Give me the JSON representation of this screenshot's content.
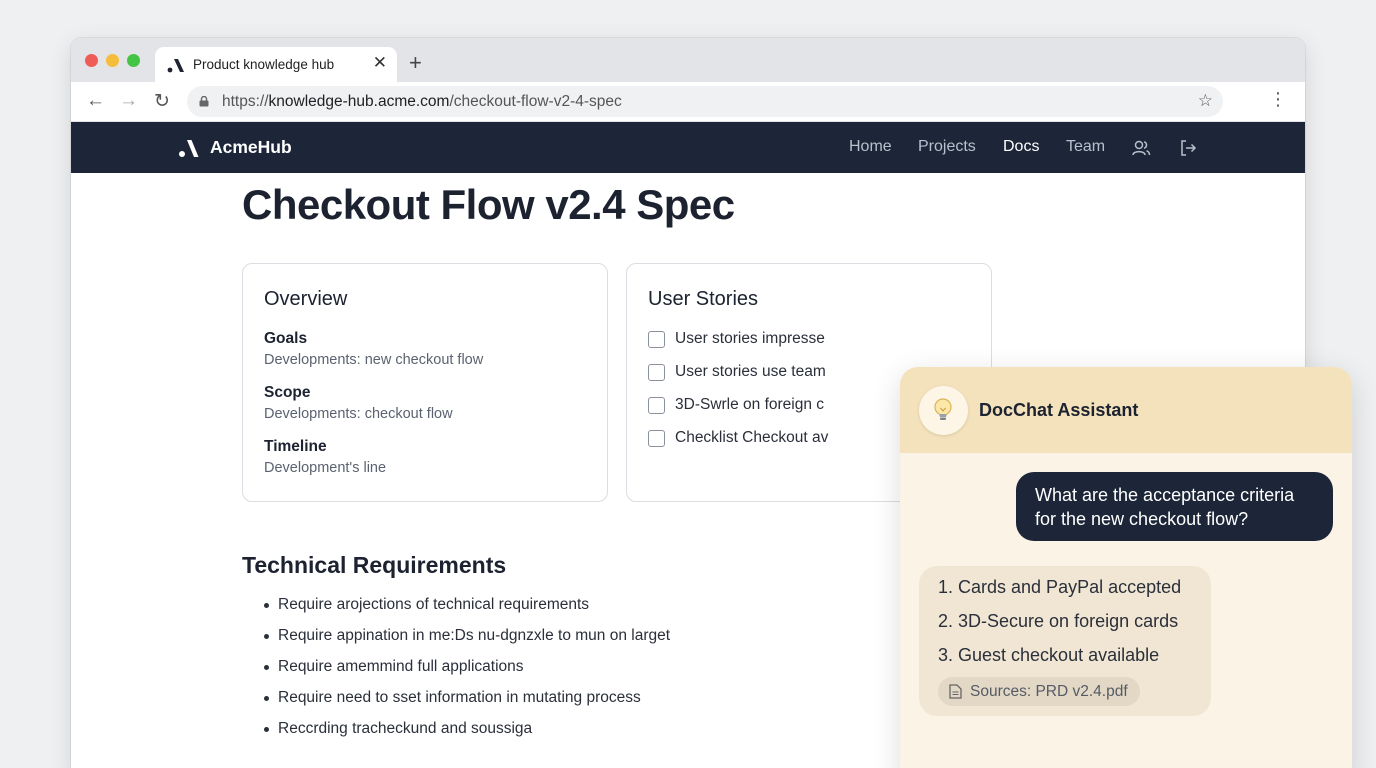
{
  "browser": {
    "tab_title": "Product knowledge hub",
    "url_prefix": "https://",
    "url_host": "knowledge-hub.acme.com",
    "url_path": "/checkout-flow-v2-4-spec"
  },
  "site": {
    "brand": "AcmeHub",
    "nav": [
      "Home",
      "Projects",
      "Docs",
      "Team"
    ],
    "active_nav": "Docs"
  },
  "page": {
    "title": "Checkout Flow v2.4 Spec",
    "overview": {
      "heading": "Overview",
      "items": [
        {
          "label": "Goals",
          "value": "Developments: new checkout flow"
        },
        {
          "label": "Scope",
          "value": "Developments: checkout flow"
        },
        {
          "label": "Timeline",
          "value": "Development's line"
        }
      ]
    },
    "user_stories": {
      "heading": "User Stories",
      "items": [
        "User stories impresse",
        "User stories use team",
        "3D-Swrle on foreign c",
        "Checklist Checkout av"
      ]
    },
    "technical": {
      "heading": "Technical Requirements",
      "items": [
        "Require arojections of technical requirements",
        "Require appination in me:Ds nu-dgnzxle to mun on larget",
        "Require amemmind full applications",
        "Require need to sset information in mutating process",
        "Reccrding tracheckund and soussiga"
      ]
    }
  },
  "chat": {
    "title": "DocChat Assistant",
    "user_message": "What are the acceptance criteria for the new checkout flow?",
    "bot_lines": [
      "1. Cards and PayPal accepted",
      "2. 3D-Secure on foreign cards",
      "3. Guest checkout available"
    ],
    "source": "Sources: PRD v2.4.pdf"
  },
  "icons": {
    "tab_logo": "acme-logo-icon",
    "lock": "lock-icon",
    "star": "bookmark-star-icon",
    "team": "users-icon",
    "logout": "logout-icon",
    "assistant": "lightbulb-icon",
    "file": "document-icon"
  },
  "colors": {
    "header_bg": "#1c2638",
    "chat_header": "#f4e2bc",
    "chat_bg": "#fbf4e6",
    "user_bubble": "#1c2638",
    "bot_bubble": "#f0e6d3"
  }
}
